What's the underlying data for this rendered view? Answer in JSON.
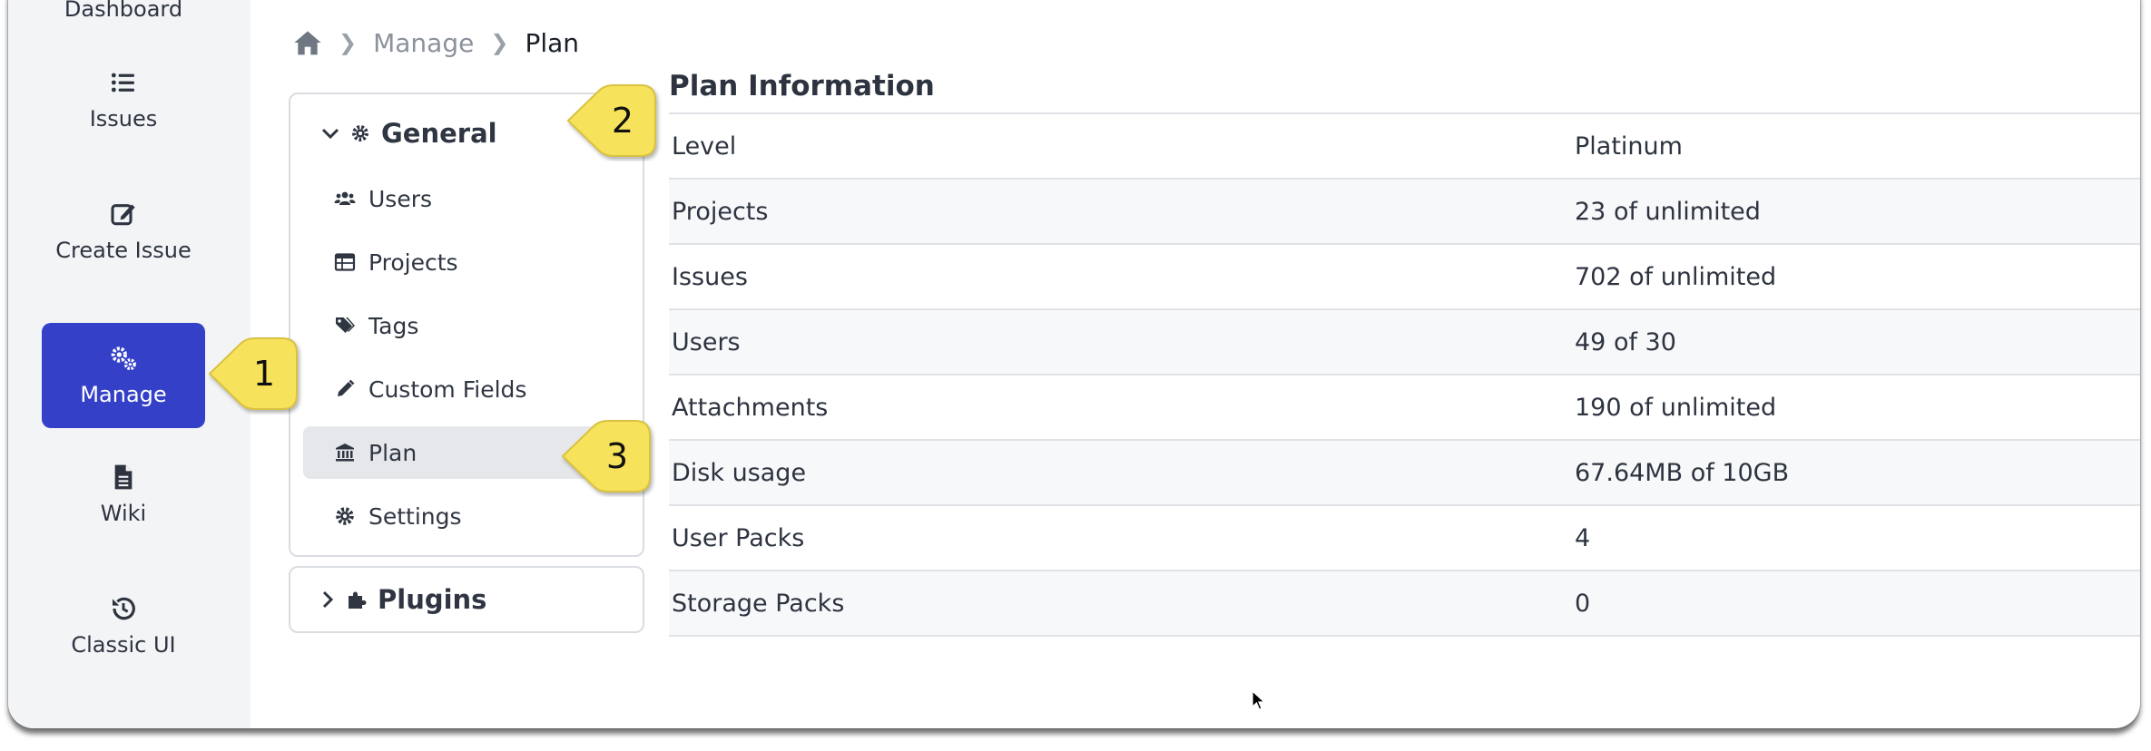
{
  "rail": {
    "items": [
      {
        "label": "Dashboard",
        "icon": "dashboard-icon"
      },
      {
        "label": "Issues",
        "icon": "list-icon"
      },
      {
        "label": "Create Issue",
        "icon": "edit-icon"
      },
      {
        "label": "Manage",
        "icon": "gears-icon",
        "active": true
      },
      {
        "label": "Wiki",
        "icon": "document-icon"
      },
      {
        "label": "Classic UI",
        "icon": "history-icon"
      }
    ]
  },
  "breadcrumb": {
    "home_icon": "home-icon",
    "items": [
      "Manage",
      "Plan"
    ]
  },
  "nav": {
    "general": {
      "label": "General",
      "items": [
        {
          "label": "Users",
          "icon": "users-icon"
        },
        {
          "label": "Projects",
          "icon": "table-icon"
        },
        {
          "label": "Tags",
          "icon": "tags-icon"
        },
        {
          "label": "Custom Fields",
          "icon": "pencil-icon"
        },
        {
          "label": "Plan",
          "icon": "bank-icon",
          "active": true
        },
        {
          "label": "Settings",
          "icon": "gear-icon"
        }
      ]
    },
    "plugins": {
      "label": "Plugins"
    }
  },
  "plan": {
    "title": "Plan Information",
    "rows": [
      {
        "key": "Level",
        "value": "Platinum"
      },
      {
        "key": "Projects",
        "value": "23 of unlimited"
      },
      {
        "key": "Issues",
        "value": "702 of unlimited"
      },
      {
        "key": "Users",
        "value": "49 of 30"
      },
      {
        "key": "Attachments",
        "value": "190 of unlimited"
      },
      {
        "key": "Disk usage",
        "value": "67.64MB of 10GB"
      },
      {
        "key": "User Packs",
        "value": "4"
      },
      {
        "key": "Storage Packs",
        "value": "0"
      }
    ]
  },
  "callouts": [
    "1",
    "2",
    "3"
  ],
  "colors": {
    "accent": "#3340c7",
    "callout": "#f7e35b"
  }
}
